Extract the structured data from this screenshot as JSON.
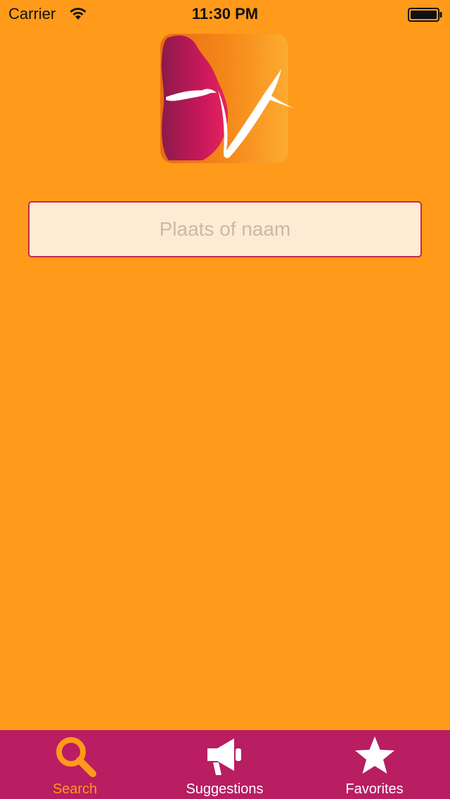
{
  "status_bar": {
    "carrier": "Carrier",
    "time": "11:30 PM",
    "wifi_icon": "wifi-icon",
    "battery_icon": "battery-icon"
  },
  "logo": {
    "icon": "pregnant-woman-logo"
  },
  "search": {
    "value": "",
    "placeholder": "Plaats of naam"
  },
  "tab_bar": {
    "tabs": [
      {
        "label": "Search",
        "icon": "search-icon",
        "active": true
      },
      {
        "label": "Suggestions",
        "icon": "megaphone-icon",
        "active": false
      },
      {
        "label": "Favorites",
        "icon": "star-icon",
        "active": false
      }
    ]
  },
  "colors": {
    "background": "#ff9a1a",
    "tab_bar": "#b91d62",
    "input_border": "#c8284f",
    "input_background": "#fdebd3",
    "active_tab": "#ff9a1a"
  }
}
